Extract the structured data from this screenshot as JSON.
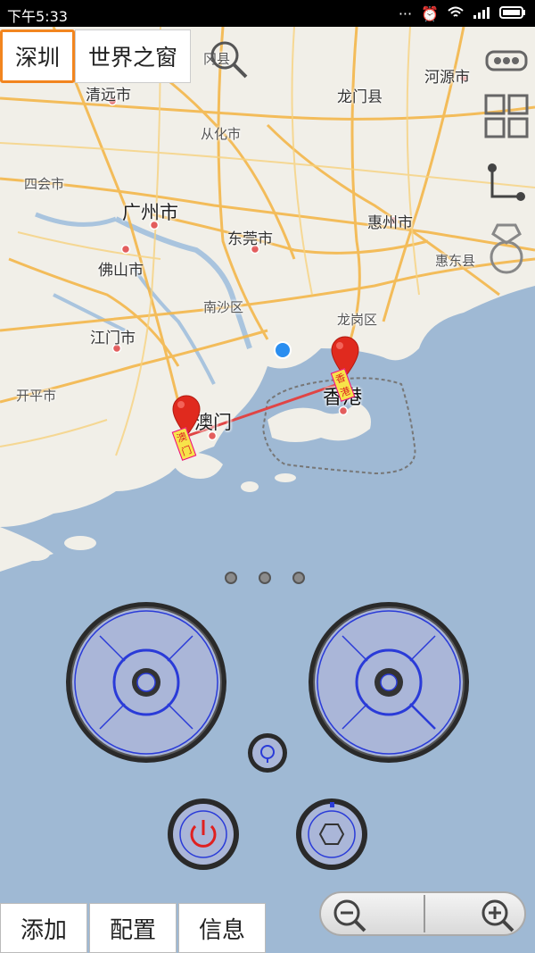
{
  "status_bar": {
    "time": "下午5:33",
    "icons": [
      "more-icon",
      "alarm-icon",
      "wifi-icon",
      "signal-icon",
      "battery-icon"
    ]
  },
  "tabs": [
    {
      "label": "深圳",
      "active": true
    },
    {
      "label": "世界之窗",
      "active": false
    }
  ],
  "map": {
    "labels": {
      "qingyuan": "清远市",
      "longmen": "龙门县",
      "heyuan": "河源市",
      "conghua": "从化市",
      "sihui": "四会市",
      "guangzhou": "广州市",
      "dongguan": "东莞市",
      "huizhou": "惠州市",
      "foshan": "佛山市",
      "huidong": "惠东县",
      "nansha": "南沙区",
      "longgang": "龙岗区",
      "jiangmen": "江门市",
      "kaiping": "开平市",
      "macau": "澳门",
      "hongkong": "香港",
      "xianxian": "冈县"
    },
    "markers": [
      {
        "name": "macau-marker",
        "badge": "澳门"
      },
      {
        "name": "hongkong-marker",
        "badge": "香港"
      }
    ]
  },
  "right_icons": [
    "vr-glasses-icon",
    "grid-icon",
    "route-icon",
    "ring-icon"
  ],
  "page_dots": 3,
  "controls": {
    "power_color": "#e02020",
    "accent": "#2a3bd8"
  },
  "bottom_buttons": [
    "添加",
    "配置",
    "信息"
  ],
  "zoom": {
    "out": "zoom-out-icon",
    "in": "zoom-in-icon"
  }
}
